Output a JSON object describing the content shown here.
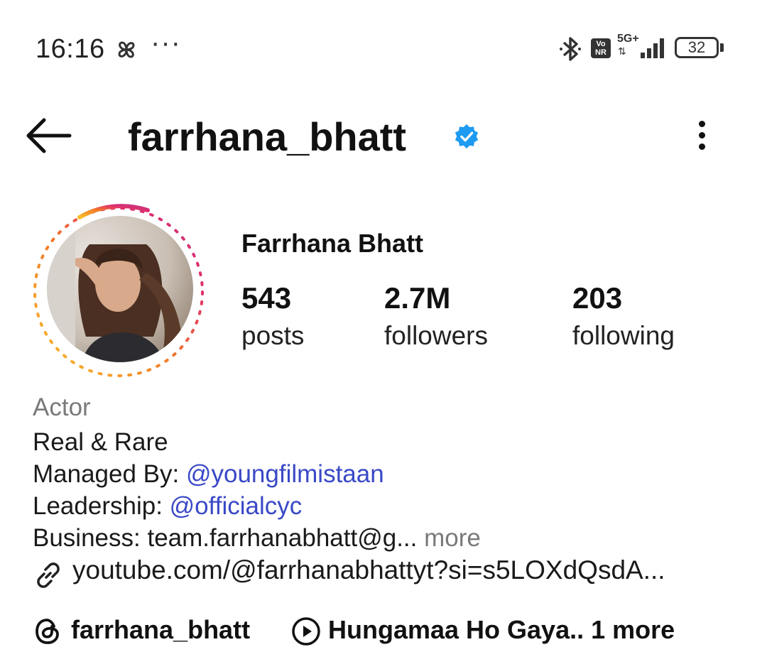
{
  "status_bar": {
    "time": "16:16",
    "overflow": "···",
    "network": "5G+",
    "vonr_top": "Vo",
    "vonr_bottom": "NR",
    "battery": "32",
    "icons": [
      "pinwheel-icon",
      "bluetooth-icon",
      "vonr-icon",
      "signal-icon",
      "battery-icon"
    ]
  },
  "header": {
    "username": "farrhana_bhatt",
    "verified": true,
    "accent_color": "#1d9bf0"
  },
  "profile": {
    "display_name": "Farrhana Bhatt",
    "stats": [
      {
        "value": "543",
        "label": "posts"
      },
      {
        "value": "2.7M",
        "label": "followers"
      },
      {
        "value": "203",
        "label": "following"
      }
    ]
  },
  "bio": {
    "category": "Actor",
    "line1": "Real & Rare",
    "managed_prefix": "Managed By: ",
    "managed_handle": "@youngfilmistaan",
    "leadership_prefix": "Leadership: ",
    "leadership_handle": "@officialcyc",
    "business": "Business: team.farrhanabhatt@g...",
    "more": "more",
    "link": "youtube.com/@farrhanabhattyt?si=s5LOXdQsdA..."
  },
  "chips": {
    "threads": "farrhana_bhatt",
    "music": "Hungamaa Ho Gaya..",
    "more": "1 more"
  },
  "colors": {
    "mention": "#3949c6",
    "muted": "#7a7a7a",
    "story_gradient": [
      "#f9c02b",
      "#f27b28",
      "#e1306c",
      "#c13584"
    ]
  }
}
